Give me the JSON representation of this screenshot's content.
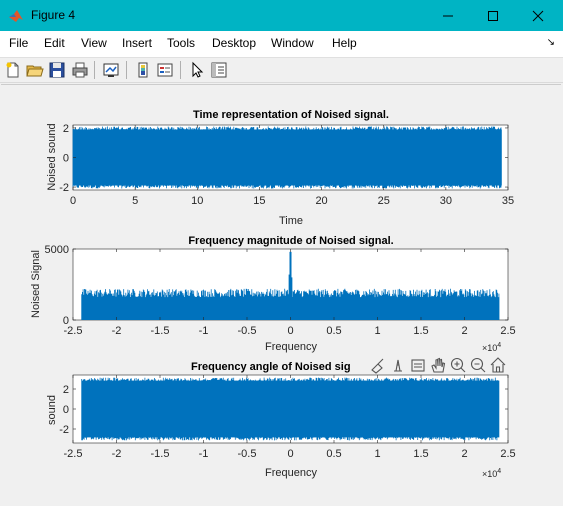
{
  "window": {
    "title": "Figure 4"
  },
  "menu": [
    "File",
    "Edit",
    "View",
    "Insert",
    "Tools",
    "Desktop",
    "Window",
    "Help"
  ],
  "toolbar_icons": [
    "new-figure-icon",
    "open-file-icon",
    "save-icon",
    "print-icon",
    "link-plot-icon",
    "colorbar-icon",
    "legend-icon",
    "edit-plot-pointer-icon",
    "property-inspector-icon"
  ],
  "axes_toolbar_icons": [
    "brush-icon",
    "data-tip-icon",
    "restore-view-icon",
    "pan-hand-icon",
    "zoom-in-icon",
    "zoom-out-icon",
    "home-icon"
  ],
  "colors": {
    "plot": "#0072bd",
    "titlebar": "#00b4c4"
  },
  "chart_data": [
    {
      "type": "line",
      "title": "Time representation of Noised signal.",
      "xlabel": "Time",
      "ylabel": "Noised sound",
      "xlim": [
        0,
        35
      ],
      "ylim": [
        -2.2,
        2.2
      ],
      "xticks": [
        0,
        5,
        10,
        15,
        20,
        25,
        30,
        35
      ],
      "yticks": [
        -2,
        0,
        2
      ],
      "series": [
        {
          "x_range": [
            0,
            34.5
          ],
          "y_band": [
            -2.1,
            2.1
          ]
        }
      ]
    },
    {
      "type": "line",
      "title": "Frequency magnitude of Noised signal.",
      "xlabel": "Frequency",
      "ylabel": "Noised Signal",
      "x_multiplier": "x10^4",
      "xlim": [
        -2.5,
        2.5
      ],
      "ylim": [
        0,
        5000
      ],
      "xticks": [
        -2.5,
        -2,
        -1.5,
        -1,
        -0.5,
        0,
        0.5,
        1,
        1.5,
        2,
        2.5
      ],
      "yticks": [
        0,
        5000
      ],
      "series": [
        {
          "x_range": [
            -2.4,
            2.4
          ],
          "noise_floor": [
            1600,
            2200
          ],
          "peaks": [
            {
              "x": 0.0,
              "y": 4800
            },
            {
              "x": -0.01,
              "y": 3200
            },
            {
              "x": 0.01,
              "y": 3000
            }
          ]
        }
      ]
    },
    {
      "type": "line",
      "title": "Frequency angle of Noised sig",
      "xlabel": "Frequency",
      "ylabel": "sound",
      "x_multiplier": "x10^4",
      "xlim": [
        -2.5,
        2.5
      ],
      "ylim": [
        -3.4,
        3.4
      ],
      "xticks": [
        -2.5,
        -2,
        -1.5,
        -1,
        -0.5,
        0,
        0.5,
        1,
        1.5,
        2,
        2.5
      ],
      "yticks": [
        -2,
        0,
        2
      ],
      "series": [
        {
          "x_range": [
            -2.4,
            2.4
          ],
          "y_band": [
            -3.14,
            3.14
          ]
        }
      ]
    }
  ]
}
